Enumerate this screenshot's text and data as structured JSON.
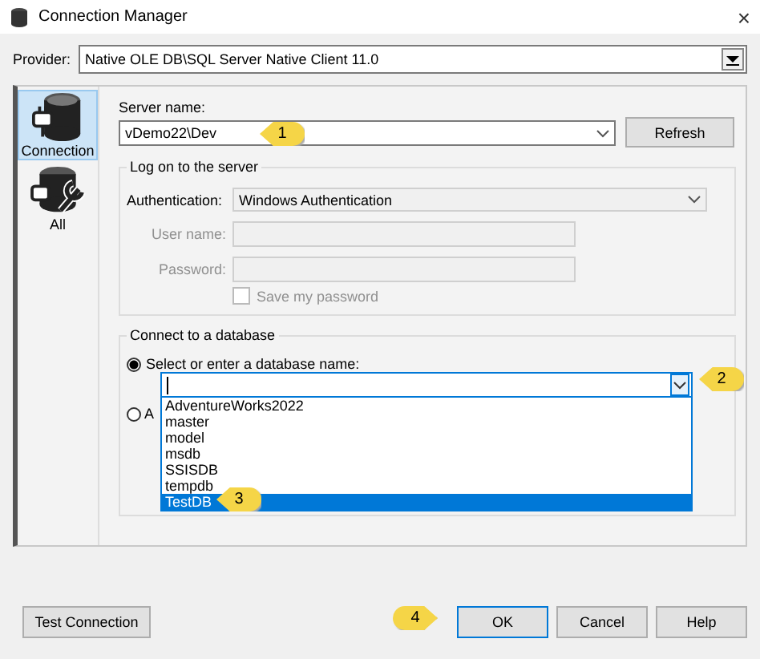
{
  "window": {
    "title": "Connection Manager",
    "close": "×"
  },
  "provider": {
    "label": "Provider:",
    "value": "Native OLE DB\\SQL Server Native Client 11.0"
  },
  "sidebar": {
    "items": [
      {
        "label": "Connection",
        "kind": "connection",
        "selected": true
      },
      {
        "label": "All",
        "kind": "all",
        "selected": false
      }
    ]
  },
  "server": {
    "label": "Server name:",
    "value": "vDemo22\\Dev",
    "refresh": "Refresh"
  },
  "logon": {
    "title": "Log on to the server",
    "auth_label": "Authentication:",
    "auth_value": "Windows Authentication",
    "user_label": "User name:",
    "password_label": "Password:",
    "save_password": {
      "label": "Save my password",
      "checked": false,
      "disabled": true
    }
  },
  "database": {
    "title": "Connect to a database",
    "options": [
      {
        "label": "Select or enter a database name:",
        "selected": true
      },
      {
        "label": "A",
        "selected": false
      }
    ],
    "items": [
      {
        "label": "AdventureWorks2022",
        "selected": false
      },
      {
        "label": "master",
        "selected": false
      },
      {
        "label": "model",
        "selected": false
      },
      {
        "label": "msdb",
        "selected": false
      },
      {
        "label": "SSISDB",
        "selected": false
      },
      {
        "label": "tempdb",
        "selected": false
      },
      {
        "label": "TestDB",
        "selected": true
      }
    ]
  },
  "callouts": [
    {
      "label": "1",
      "kind": "left"
    },
    {
      "label": "2",
      "kind": "left"
    },
    {
      "label": "3",
      "kind": "left"
    },
    {
      "label": "4",
      "kind": "right"
    }
  ],
  "buttons": {
    "test": "Test Connection",
    "ok": "OK",
    "cancel": "Cancel",
    "help": "Help"
  }
}
